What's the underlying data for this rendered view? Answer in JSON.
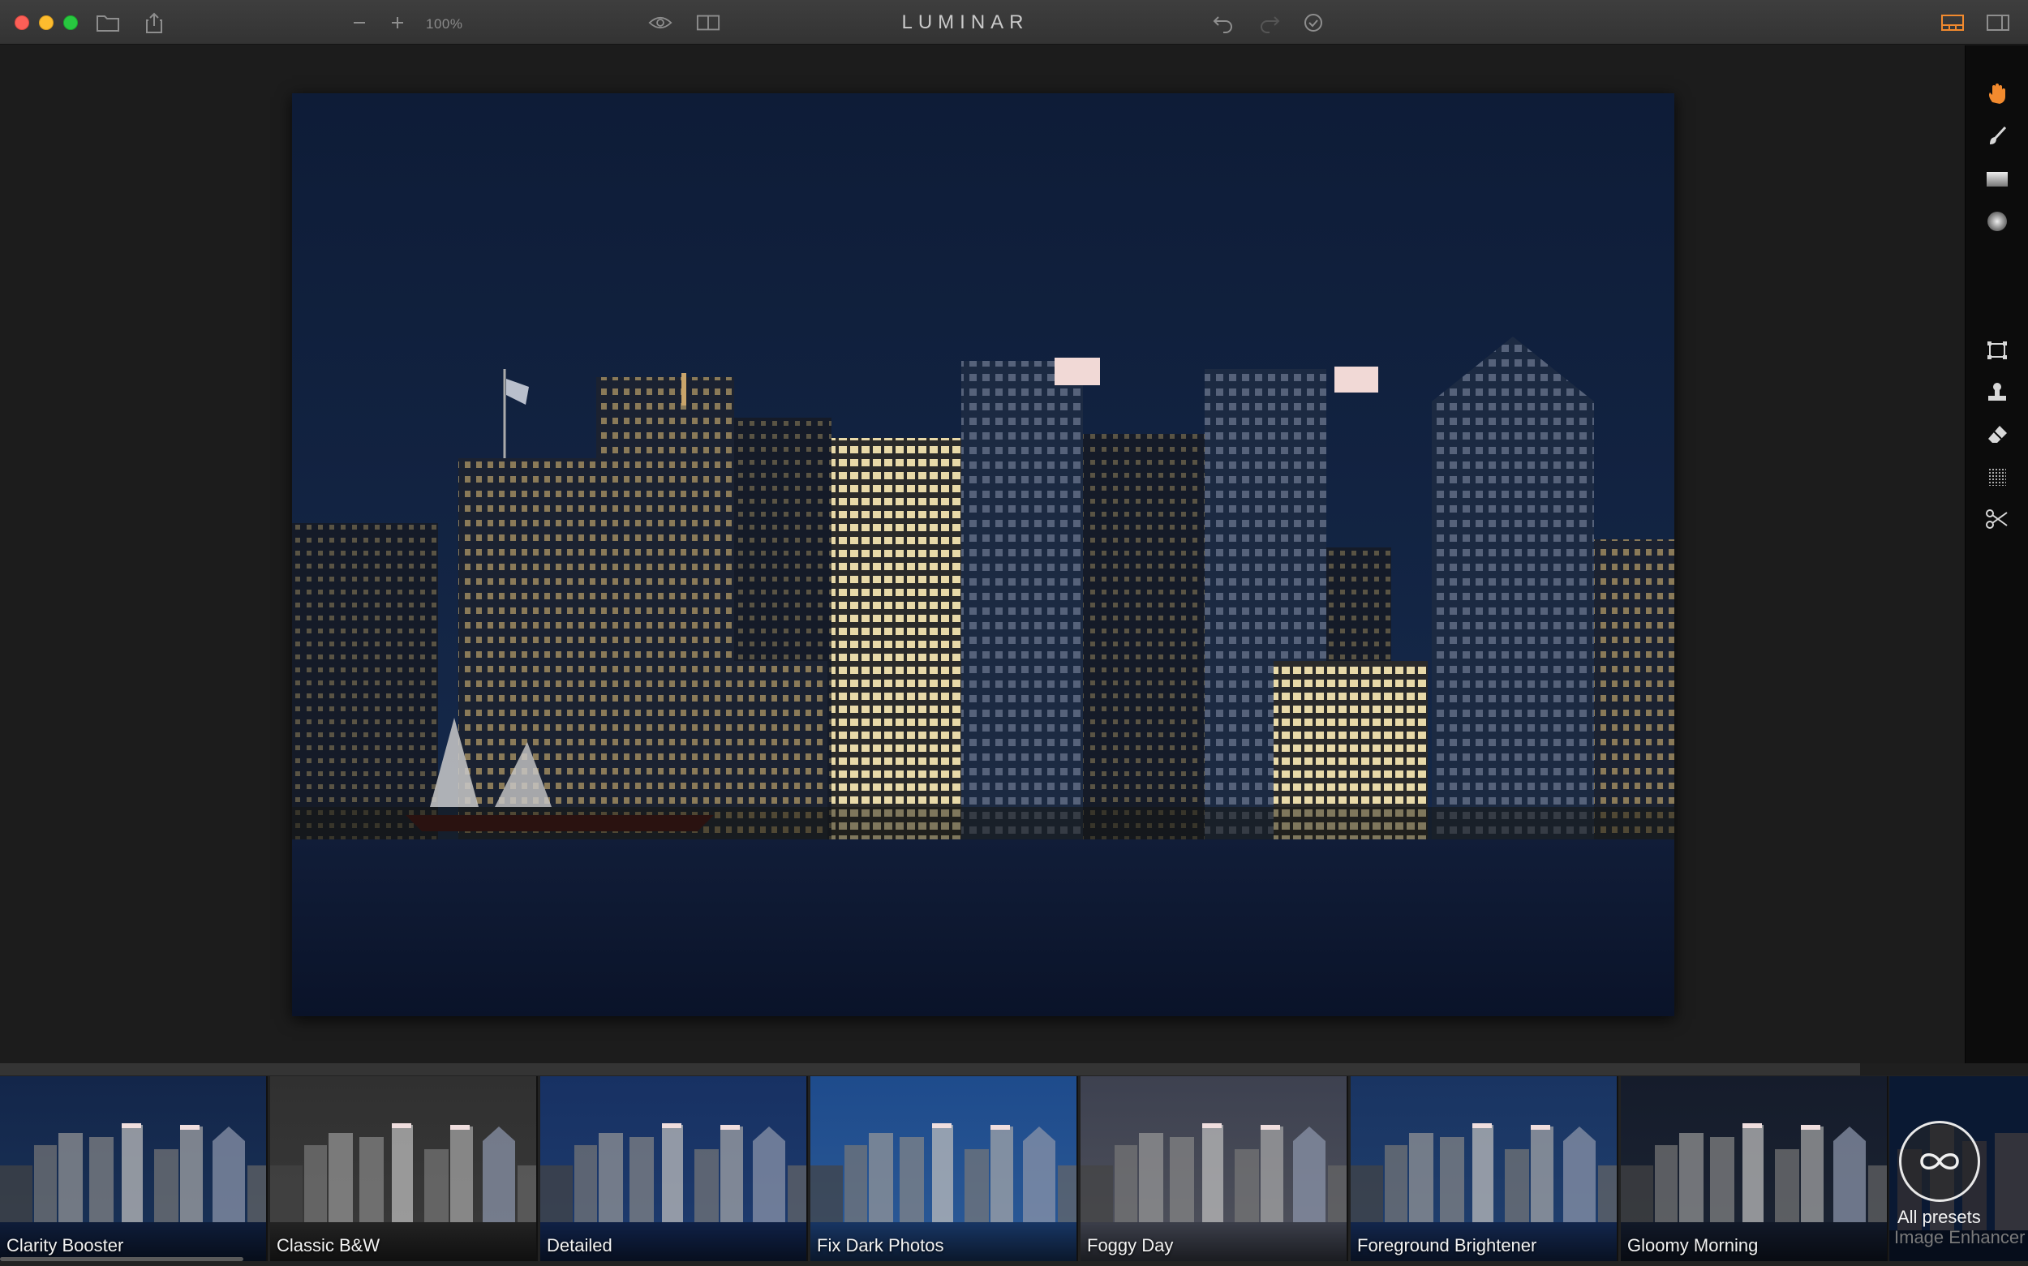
{
  "window": {
    "app_title": "LUMINAR"
  },
  "toolbar": {
    "zoom_value": "100%",
    "icons": [
      "folder-icon",
      "share-icon",
      "zoom-out-icon",
      "zoom-in-icon",
      "eye-preview-icon",
      "compare-split-icon",
      "undo-icon",
      "redo-icon",
      "history-icon",
      "layout-filmstrip-icon",
      "layout-sidepanel-icon"
    ]
  },
  "right_tools": [
    "hand-tool-icon",
    "brush-tool-icon",
    "gradient-tool-icon",
    "radial-tool-icon",
    "crop-tool-icon",
    "clone-stamp-tool-icon",
    "erase-tool-icon",
    "noise-tool-icon",
    "cut-tool-icon"
  ],
  "presets": {
    "items": [
      {
        "label": "Clarity Booster",
        "sky_top": "#13264a",
        "sky_bottom": "#1a3358",
        "water": "#0e1c38"
      },
      {
        "label": "Classic B&W",
        "sky_top": "#303030",
        "sky_bottom": "#3a3a3a",
        "water": "#222222"
      },
      {
        "label": "Detailed",
        "sky_top": "#173163",
        "sky_bottom": "#1f3c6e",
        "water": "#0f2044"
      },
      {
        "label": "Fix Dark Photos",
        "sky_top": "#1e4b8c",
        "sky_bottom": "#2c5a96",
        "water": "#173461"
      },
      {
        "label": "Foggy Day",
        "sky_top": "#3d4150",
        "sky_bottom": "#50525c",
        "water": "#3a3d48"
      },
      {
        "label": "Foreground Brightener",
        "sky_top": "#193462",
        "sky_bottom": "#21406e",
        "water": "#12254a"
      },
      {
        "label": "Gloomy Morning",
        "sky_top": "#151c2b",
        "sky_bottom": "#1c2433",
        "water": "#111827"
      }
    ],
    "all_presets_label": "All presets",
    "next_preset_label": "Image Enhancer"
  },
  "colors": {
    "accent_hand": "#f28a2e",
    "photo_sky_top": "#0f1e3a",
    "photo_sky_bottom": "#14284a",
    "photo_water": "#0c1630"
  }
}
